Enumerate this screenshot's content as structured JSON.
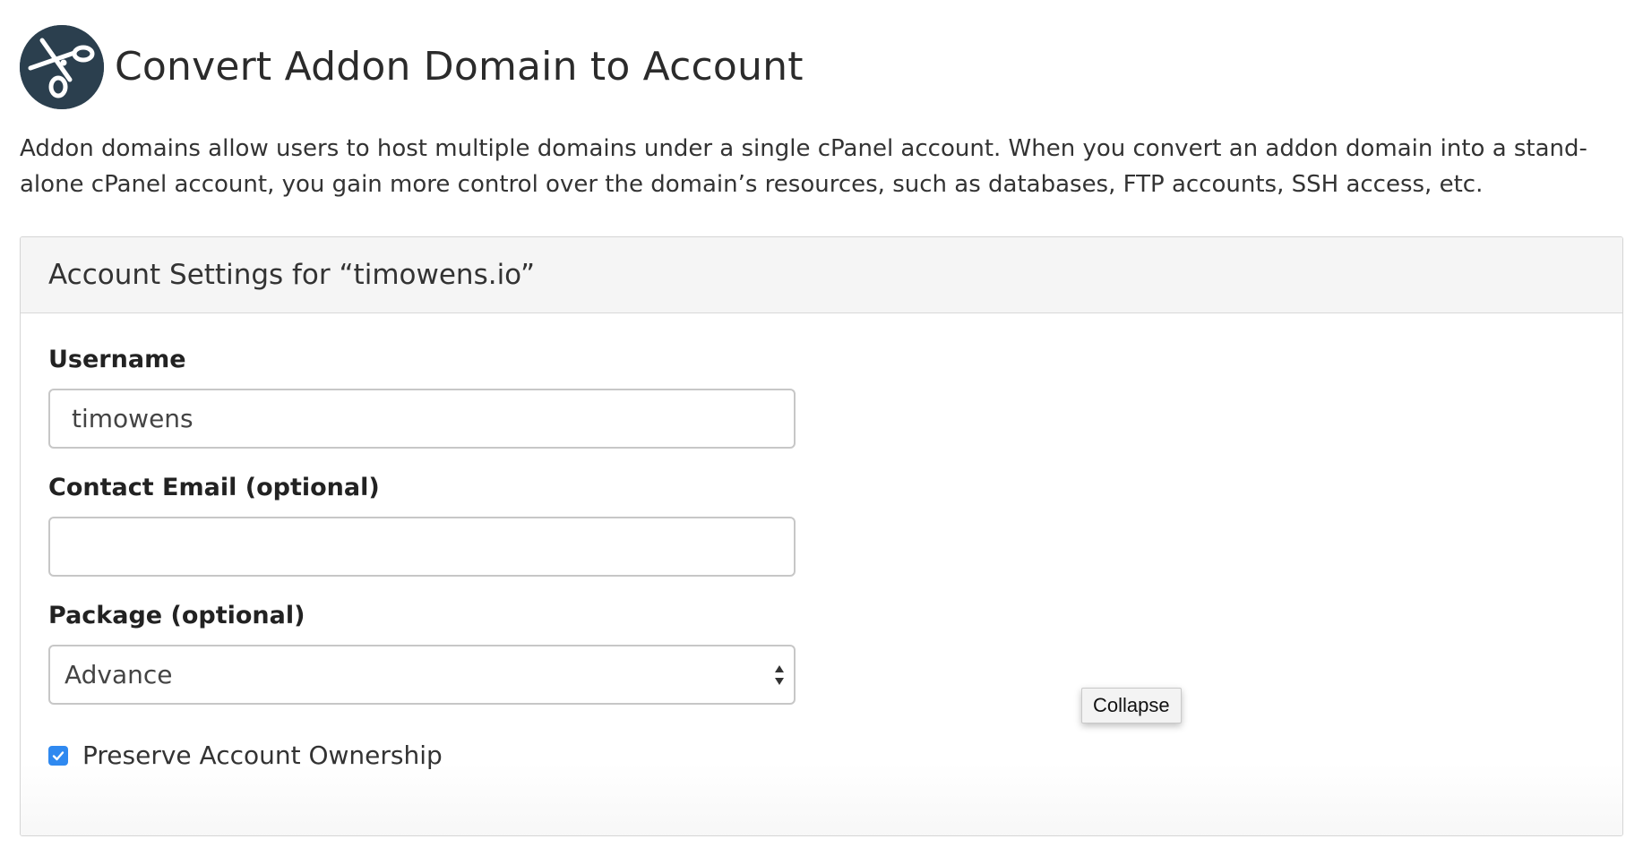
{
  "header": {
    "icon": "scissors-icon",
    "title": "Convert Addon Domain to Account"
  },
  "description": "Addon domains allow users to host multiple domains under a single cPanel account. When you convert an addon domain into a stand-alone cPanel account, you gain more control over the domain’s resources, such as databases, FTP accounts, SSH access, etc.",
  "panel": {
    "heading": "Account Settings for “timowens.io”",
    "username": {
      "label": "Username",
      "value": "timowens"
    },
    "contact_email": {
      "label": "Contact Email (optional)",
      "value": ""
    },
    "package": {
      "label": "Package (optional)",
      "selected": "Advance"
    },
    "preserve_ownership": {
      "label": "Preserve Account Ownership",
      "checked": true
    }
  },
  "tooltip": {
    "text": "Collapse"
  },
  "colors": {
    "icon_bg": "#2b3f4e",
    "checkbox": "#2f89f0",
    "panel_heading_bg": "#f5f5f5"
  }
}
